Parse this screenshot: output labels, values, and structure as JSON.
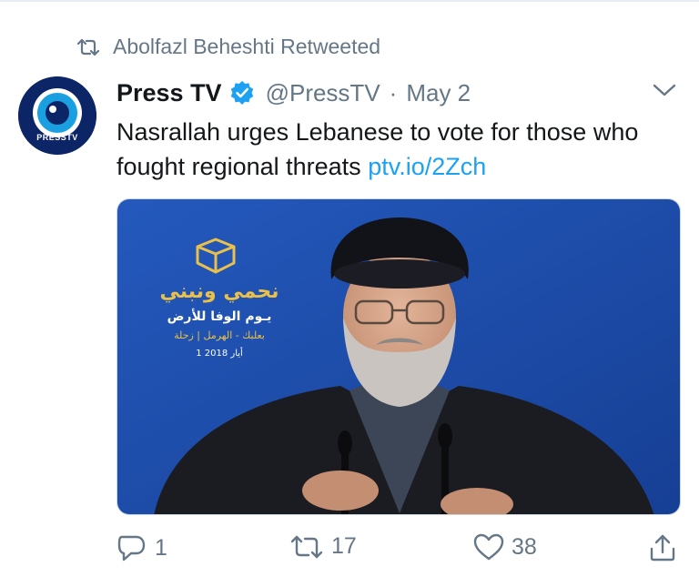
{
  "retweet": {
    "icon": "retweet-icon",
    "text": "Abolfazl Beheshti Retweeted"
  },
  "author": {
    "name": "Press TV",
    "handle": "@PressTV",
    "separator": "·",
    "date": "May 2",
    "verified_icon": "verified-badge-icon",
    "avatar_label": "PRESSTV"
  },
  "tweet": {
    "text": "Nasrallah urges Lebanese to vote for those who fought regional threats",
    "link": "ptv.io/2Zch"
  },
  "media": {
    "banner_title": "نحمي ونبني",
    "banner_line1": "يـوم الوفا للأرض",
    "banner_line2": "بعلبك - الهرمل | زحلة",
    "banner_date": "1 أيار 2018"
  },
  "actions": {
    "reply_count": "1",
    "retweet_count": "17",
    "like_count": "38"
  },
  "colors": {
    "link": "#1da1f2",
    "muted": "#657786",
    "text": "#14171a",
    "media_background": "#1f4fae"
  }
}
